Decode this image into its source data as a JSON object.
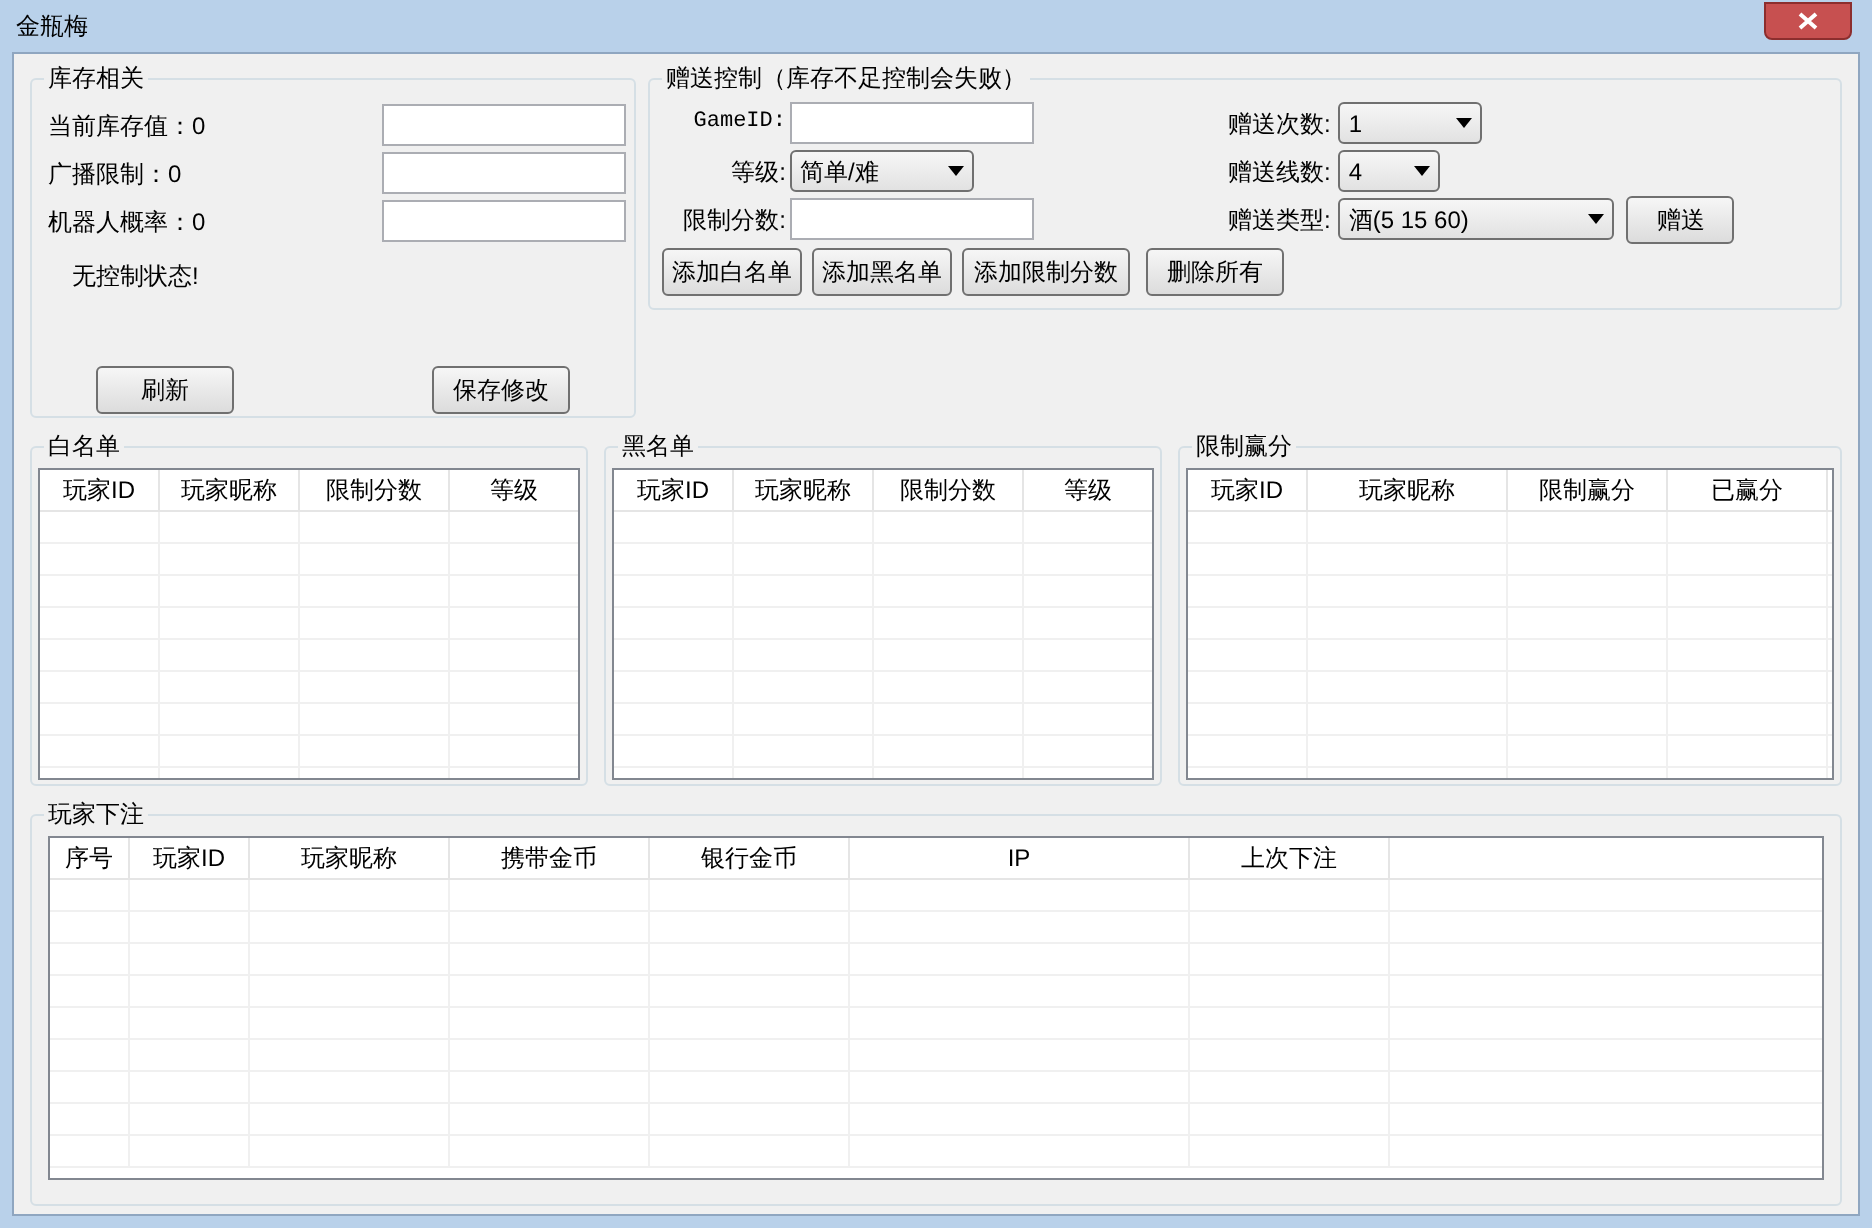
{
  "window": {
    "title": "金瓶梅"
  },
  "stock": {
    "title": "库存相关",
    "fields": [
      {
        "label": "当前库存值：0"
      },
      {
        "label": "广播限制：0"
      },
      {
        "label": "机器人概率：0"
      }
    ],
    "status": "无控制状态!",
    "buttons": [
      "刷新",
      "保存修改"
    ]
  },
  "gift": {
    "title": "赠送控制（库存不足控制会失败）",
    "left": [
      {
        "kind": "input",
        "label": "GameID:"
      },
      {
        "kind": "select",
        "label": "等级:",
        "value": "简单/难"
      },
      {
        "kind": "input",
        "label": "限制分数:"
      }
    ],
    "right": [
      {
        "label": "赠送次数:",
        "value": "1"
      },
      {
        "label": "赠送线数:",
        "value": "4"
      },
      {
        "label": "赠送类型:",
        "value": "酒(5 15 60)"
      }
    ],
    "send_button": "赠送",
    "buttons": [
      "添加白名单",
      "添加黑名单",
      "添加限制分数",
      "删除所有"
    ]
  },
  "lists": [
    {
      "title": "白名单",
      "columns": [
        "玩家ID",
        "玩家昵称",
        "限制分数",
        "等级"
      ]
    },
    {
      "title": "黑名单",
      "columns": [
        "玩家ID",
        "玩家昵称",
        "限制分数",
        "等级"
      ]
    },
    {
      "title": "限制赢分",
      "columns": [
        "玩家ID",
        "玩家昵称",
        "限制赢分",
        "已赢分"
      ]
    }
  ],
  "bets": {
    "title": "玩家下注",
    "columns": [
      "序号",
      "玩家ID",
      "玩家昵称",
      "携带金币",
      "银行金币",
      "IP",
      "上次下注"
    ]
  }
}
